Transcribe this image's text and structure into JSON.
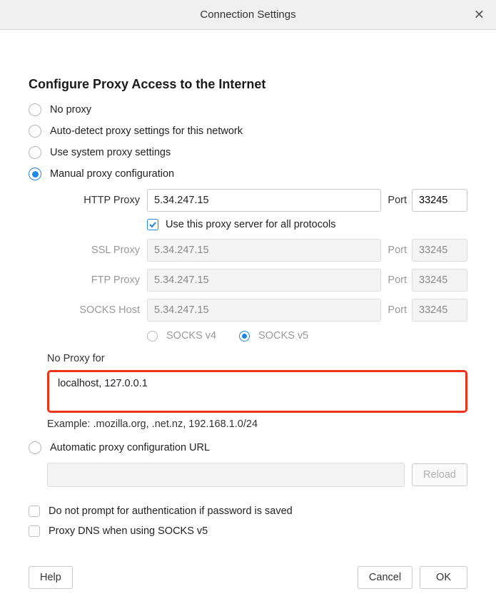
{
  "dialog": {
    "title": "Connection Settings"
  },
  "heading": "Configure Proxy Access to the Internet",
  "options": {
    "no_proxy": "No proxy",
    "auto_detect": "Auto-detect proxy settings for this network",
    "use_system": "Use system proxy settings",
    "manual": "Manual proxy configuration",
    "auto_url": "Automatic proxy configuration URL"
  },
  "labels": {
    "http_proxy": "HTTP Proxy",
    "ssl_proxy": "SSL Proxy",
    "ftp_proxy": "FTP Proxy",
    "socks_host": "SOCKS Host",
    "port": "Port",
    "use_for_all": "Use this proxy server for all protocols",
    "socks_v4": "SOCKS v4",
    "socks_v5": "SOCKS v5",
    "no_proxy_for": "No Proxy for",
    "example": "Example: .mozilla.org, .net.nz, 192.168.1.0/24",
    "do_not_prompt": "Do not prompt for authentication if password is saved",
    "proxy_dns": "Proxy DNS when using SOCKS v5"
  },
  "values": {
    "http_host": "5.34.247.15",
    "http_port": "33245",
    "ssl_host": "5.34.247.15",
    "ssl_port": "33245",
    "ftp_host": "5.34.247.15",
    "ftp_port": "33245",
    "socks_host": "5.34.247.15",
    "socks_port": "33245",
    "no_proxy_for": "localhost, 127.0.0.1",
    "auto_url": ""
  },
  "buttons": {
    "reload": "Reload",
    "help": "Help",
    "cancel": "Cancel",
    "ok": "OK"
  }
}
